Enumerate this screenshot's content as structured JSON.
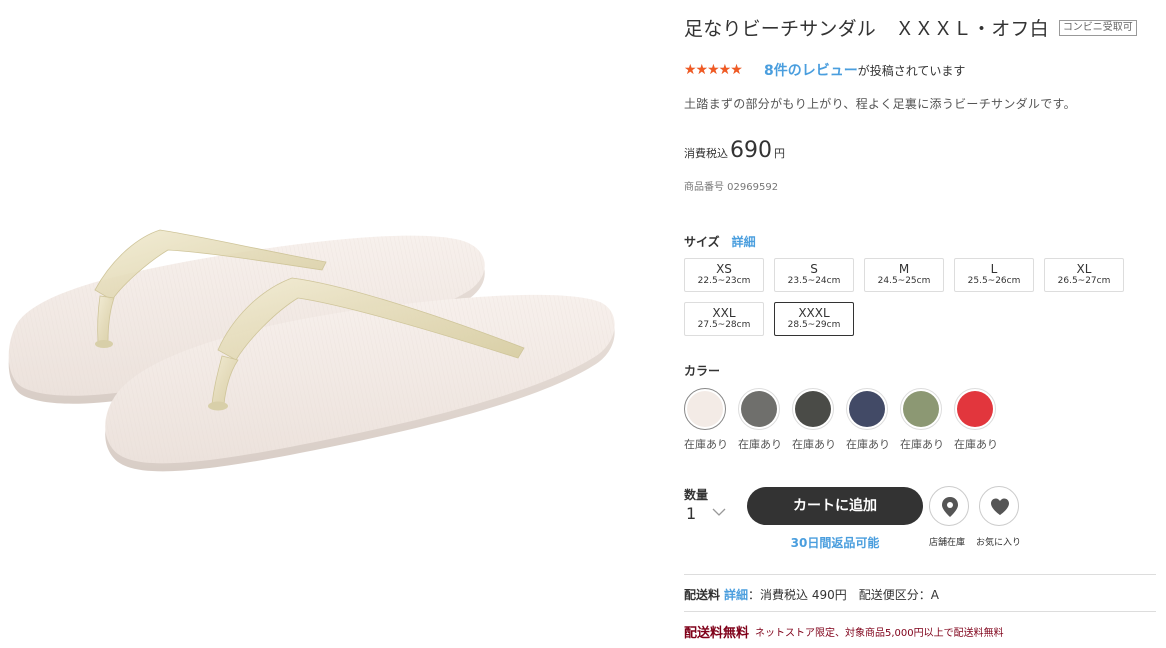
{
  "product": {
    "title": "足なりビーチサンダル　ＸＸＸＬ・オフ白",
    "cvs_badge": "コンビニ受取可",
    "rating": 4.5,
    "review_link": "8件のレビュー",
    "review_suffix": "が投稿されています",
    "description": "土踏まずの部分がもり上がり、程よく足裏に添うビーチサンダルです。",
    "price_tax_label": "消費税込",
    "price": "690",
    "price_unit": "円",
    "product_code": "商品番号  02969592"
  },
  "size": {
    "label": "サイズ",
    "detail_link": "詳細",
    "options": [
      {
        "name": "XS",
        "range": "22.5~23cm"
      },
      {
        "name": "S",
        "range": "23.5~24cm"
      },
      {
        "name": "M",
        "range": "24.5~25cm"
      },
      {
        "name": "L",
        "range": "25.5~26cm"
      },
      {
        "name": "XL",
        "range": "26.5~27cm"
      },
      {
        "name": "XXL",
        "range": "27.5~28cm"
      },
      {
        "name": "XXXL",
        "range": "28.5~29cm"
      }
    ],
    "selected": "XXXL"
  },
  "color": {
    "label": "カラー",
    "options": [
      {
        "hex": "#f3ebe6",
        "stock": "在庫あり"
      },
      {
        "hex": "#6f6f6c",
        "stock": "在庫あり"
      },
      {
        "hex": "#4a4b47",
        "stock": "在庫あり"
      },
      {
        "hex": "#424a66",
        "stock": "在庫あり"
      },
      {
        "hex": "#8c9873",
        "stock": "在庫あり"
      },
      {
        "hex": "#e2363d",
        "stock": "在庫あり"
      }
    ]
  },
  "purchase": {
    "qty_label": "数量",
    "qty_value": "1",
    "cart_button": "カートに追加",
    "returns": "30日間返品可能",
    "store_stock_caption": "店舗在庫",
    "favorite_caption": "お気に入り"
  },
  "shipping": {
    "label": "配送料",
    "detail_link": "詳細",
    "info": "：消費税込 490円　配送便区分：A",
    "free_title": "配送料無料",
    "free_note": "ネットストア限定、対象商品5,000円以上で配送料無料"
  },
  "colors": {
    "accent_blue": "#4a9ede",
    "star_orange": "#f05a24",
    "cart_dark": "#333333",
    "free_red": "#7f0019"
  }
}
